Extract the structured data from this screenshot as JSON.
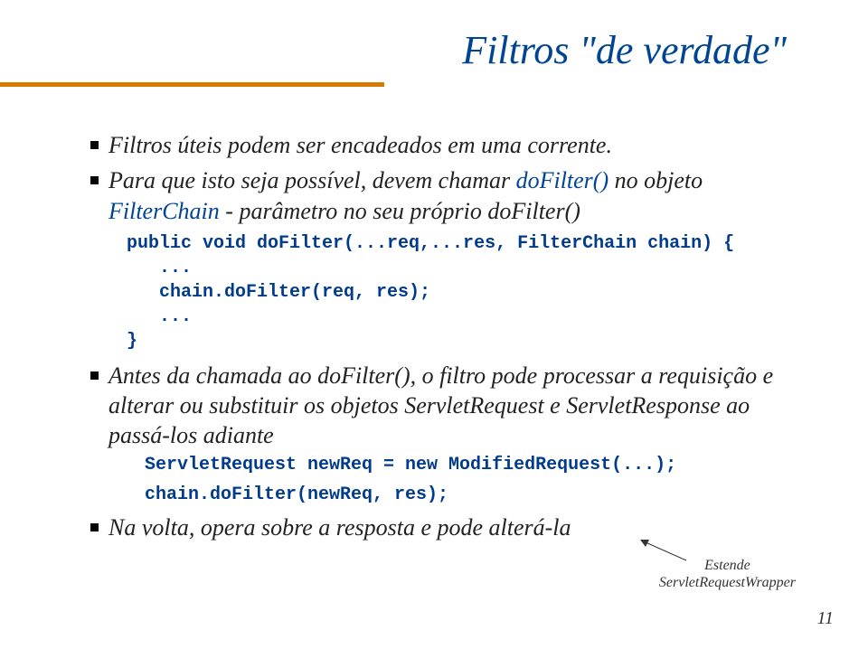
{
  "title": "Filtros \"de verdade\"",
  "bullets": {
    "b1": "Filtros úteis podem ser encadeados em uma corrente.",
    "b2_pre": "Para que isto seja possível, devem chamar ",
    "b2_call": "doFilter()",
    "b2_mid": " no objeto ",
    "b2_fc": "FilterChain",
    "b2_post": " - parâmetro no seu próprio doFilter()",
    "code1": "public void doFilter(...req,...res, FilterChain chain) {\n   ...\n   chain.doFilter(req, res);\n   ...\n}",
    "b3": "Antes da chamada ao doFilter(), o filtro pode processar a requisição e alterar ou substituir os objetos ServletRequest e ServletResponse ao passá-los adiante",
    "code2a": "ServletRequest newReq = new ModifiedRequest(...);",
    "code2b": "chain.doFilter(newReq, res);",
    "b4": "Na volta, opera sobre a resposta e pode alterá-la"
  },
  "note": {
    "l1": "Estende",
    "l2": "ServletRequestWrapper"
  },
  "page": "11"
}
